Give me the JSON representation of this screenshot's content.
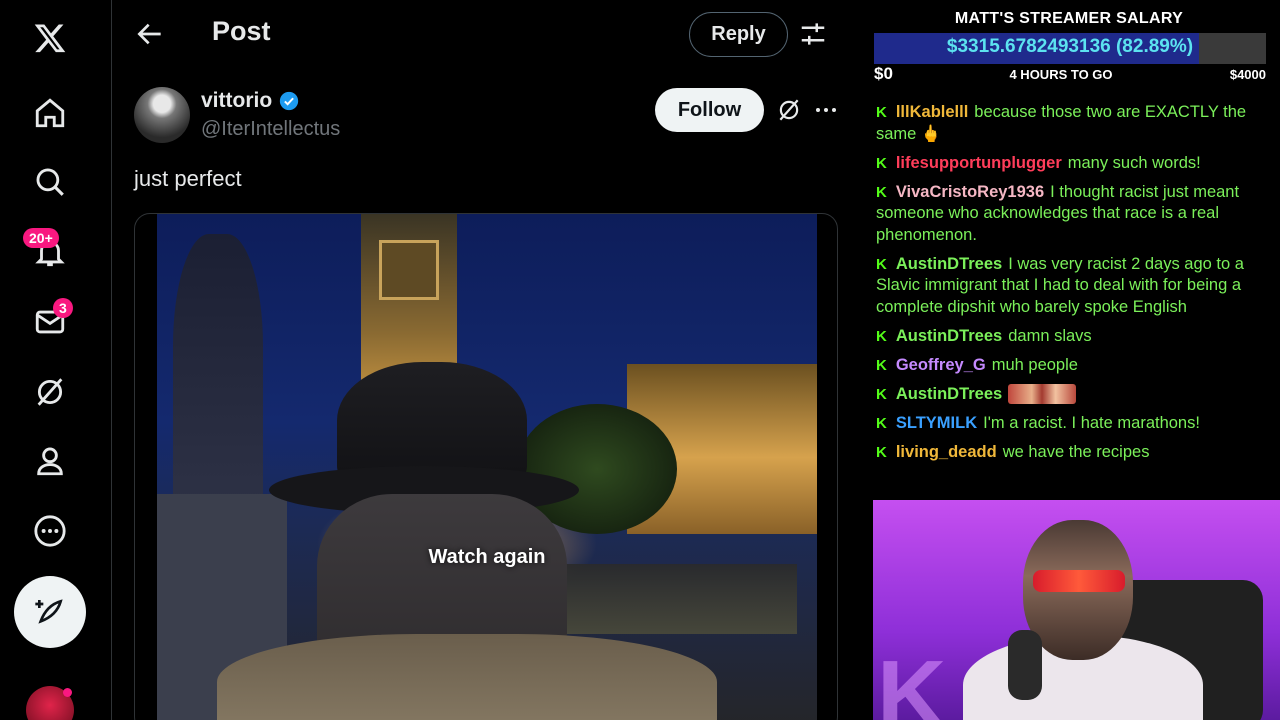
{
  "nav": {
    "items": [
      {
        "name": "x-logo-icon"
      },
      {
        "name": "home-icon"
      },
      {
        "name": "search-icon"
      },
      {
        "name": "notifications-icon",
        "badge": "20+"
      },
      {
        "name": "messages-icon",
        "badge": "3"
      },
      {
        "name": "grok-icon"
      },
      {
        "name": "profile-icon"
      },
      {
        "name": "more-icon"
      }
    ],
    "compose_icon": "compose-post-icon"
  },
  "header": {
    "title": "Post",
    "reply_label": "Reply"
  },
  "post": {
    "author_name": "vittorio",
    "author_handle": "@IterIntellectus",
    "verified": true,
    "follow_label": "Follow",
    "text": "just perfect",
    "video_overlay": "Watch again"
  },
  "stream": {
    "salary": {
      "title": "MATT'S STREAMER SALARY",
      "value": "$3315.6782493136 (82.89%)",
      "progress": 0.8289,
      "min_label": "$0",
      "time_label": "4 HOURS TO GO",
      "max_label": "$4000"
    },
    "chat": [
      {
        "user": "lllKablelll",
        "color": "#f0b83a",
        "text": "because those two are EXACTLY the same 🖕"
      },
      {
        "user": "lifesupportunplugger",
        "color": "#ff3d5a",
        "text": "many such words!"
      },
      {
        "user": "VivaCristoRey1936",
        "color": "#f5b7c4",
        "text": "I thought racist just meant someone who acknowledges that race is a real phenomenon."
      },
      {
        "user": "AustinDTrees",
        "color": "#7bf05a",
        "text": "I was very racist 2 days ago to a Slavic immigrant that I had to deal with for being a complete dipshit who barely spoke English"
      },
      {
        "user": "AustinDTrees",
        "color": "#7bf05a",
        "text": "damn slavs"
      },
      {
        "user": "Geoffrey_G",
        "color": "#c58aff",
        "text": "muh people"
      },
      {
        "user": "AustinDTrees",
        "color": "#7bf05a",
        "text": "",
        "emote": true
      },
      {
        "user": "SLTYMILK",
        "color": "#3aa0ff",
        "text": "I'm a racist. I hate marathons!"
      },
      {
        "user": "living_deadd",
        "color": "#f0b83a",
        "text": "we have the recipes"
      }
    ],
    "cam_logo": "K"
  }
}
